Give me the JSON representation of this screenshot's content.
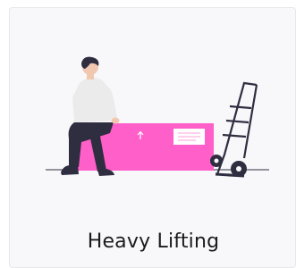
{
  "card": {
    "title": "Heavy Lifting",
    "illustration_icon": "person-sitting-on-box-with-hand-truck-icon"
  },
  "colors": {
    "card_background": "#f8f8fa",
    "box": "#ff5fc8",
    "dark": "#2f2e41",
    "shirt": "#ebebeb",
    "skin": "#f2c7b0"
  }
}
